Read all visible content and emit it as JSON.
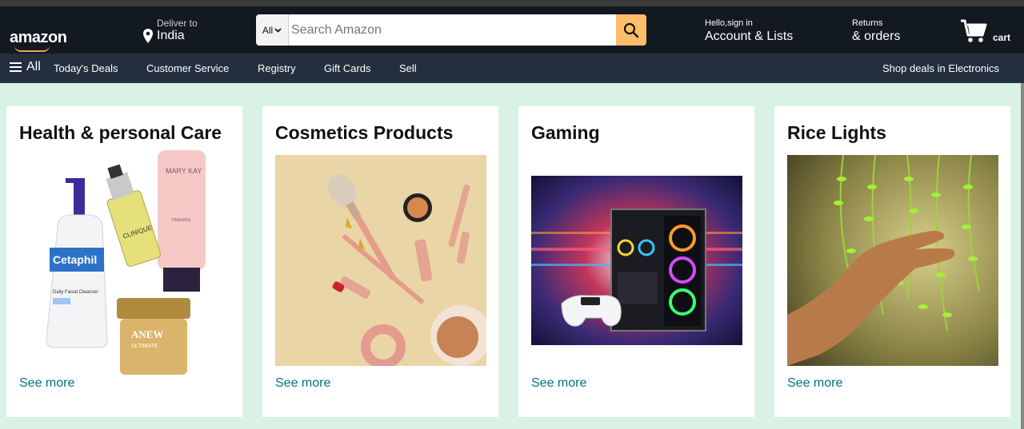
{
  "header": {
    "logo": "amazon",
    "deliver_small": "Deliver to",
    "deliver_location": "India",
    "search_category": "All",
    "search_placeholder": "Search Amazon",
    "account_small": "Hello,sign in",
    "account_big": "Account & Lists",
    "returns_small": "Returns",
    "returns_big": "& orders",
    "cart_label": "cart"
  },
  "nav": {
    "all_label": "All",
    "items": [
      "Today's Deals",
      "Customer Service",
      "Registry",
      "Gift Cards",
      "Sell"
    ],
    "right_link": "Shop deals in Electronics"
  },
  "cards": [
    {
      "title": "Health & personal Care",
      "link": "See more",
      "image": "health-products-image"
    },
    {
      "title": "Cosmetics Products",
      "link": "See more",
      "image": "cosmetics-image"
    },
    {
      "title": "Gaming",
      "link": "See more",
      "image": "gaming-pc-image"
    },
    {
      "title": "Rice Lights",
      "link": "See more",
      "image": "rice-lights-image"
    }
  ],
  "product_text": {
    "brand1": "MARY KAY",
    "brand2": "Cetaphil",
    "brand2_sub": "Daily Facial Cleanser",
    "brand3": "CLINIQUE",
    "brand4": "ANEW",
    "brand4_sub": "ULTIMATE",
    "brand1_sub": "TIMEWISE"
  },
  "colors": {
    "header_bg": "#131921",
    "nav_bg": "#232f3e",
    "page_bg": "#d9f2e4",
    "search_btn": "#febd69",
    "link": "#007185"
  }
}
